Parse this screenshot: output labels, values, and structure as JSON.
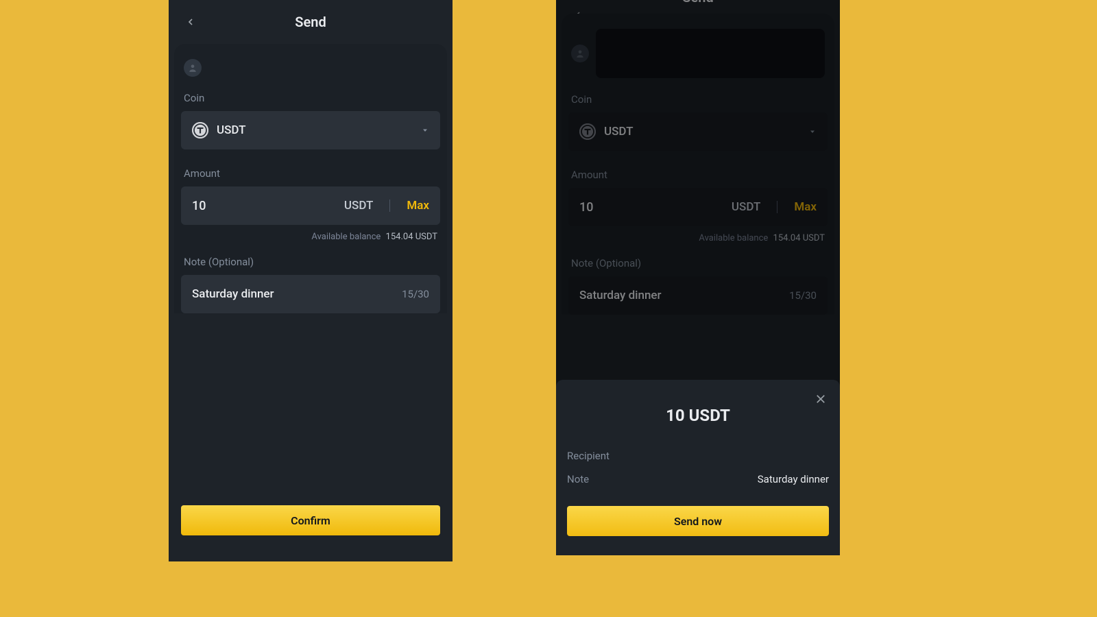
{
  "colors": {
    "accent": "#F0B90B",
    "bg_dark": "#1E2329"
  },
  "left": {
    "title": "Send",
    "coin_label": "Coin",
    "coin_value": "USDT",
    "amount_label": "Amount",
    "amount_value": "10",
    "amount_unit": "USDT",
    "max_label": "Max",
    "available_label": "Available balance",
    "available_value": "154.04 USDT",
    "note_label": "Note (Optional)",
    "note_value": "Saturday dinner",
    "note_count": "15/30",
    "confirm_label": "Confirm"
  },
  "right": {
    "title": "Send",
    "coin_label": "Coin",
    "coin_value": "USDT",
    "amount_label": "Amount",
    "amount_value": "10",
    "amount_unit": "USDT",
    "max_label": "Max",
    "available_label": "Available balance",
    "available_value": "154.04 USDT",
    "note_label": "Note (Optional)",
    "note_value": "Saturday dinner",
    "note_count": "15/30",
    "sheet": {
      "amount": "10 USDT",
      "recipient_label": "Recipient",
      "note_label": "Note",
      "note_value": "Saturday dinner",
      "send_label": "Send now"
    }
  }
}
